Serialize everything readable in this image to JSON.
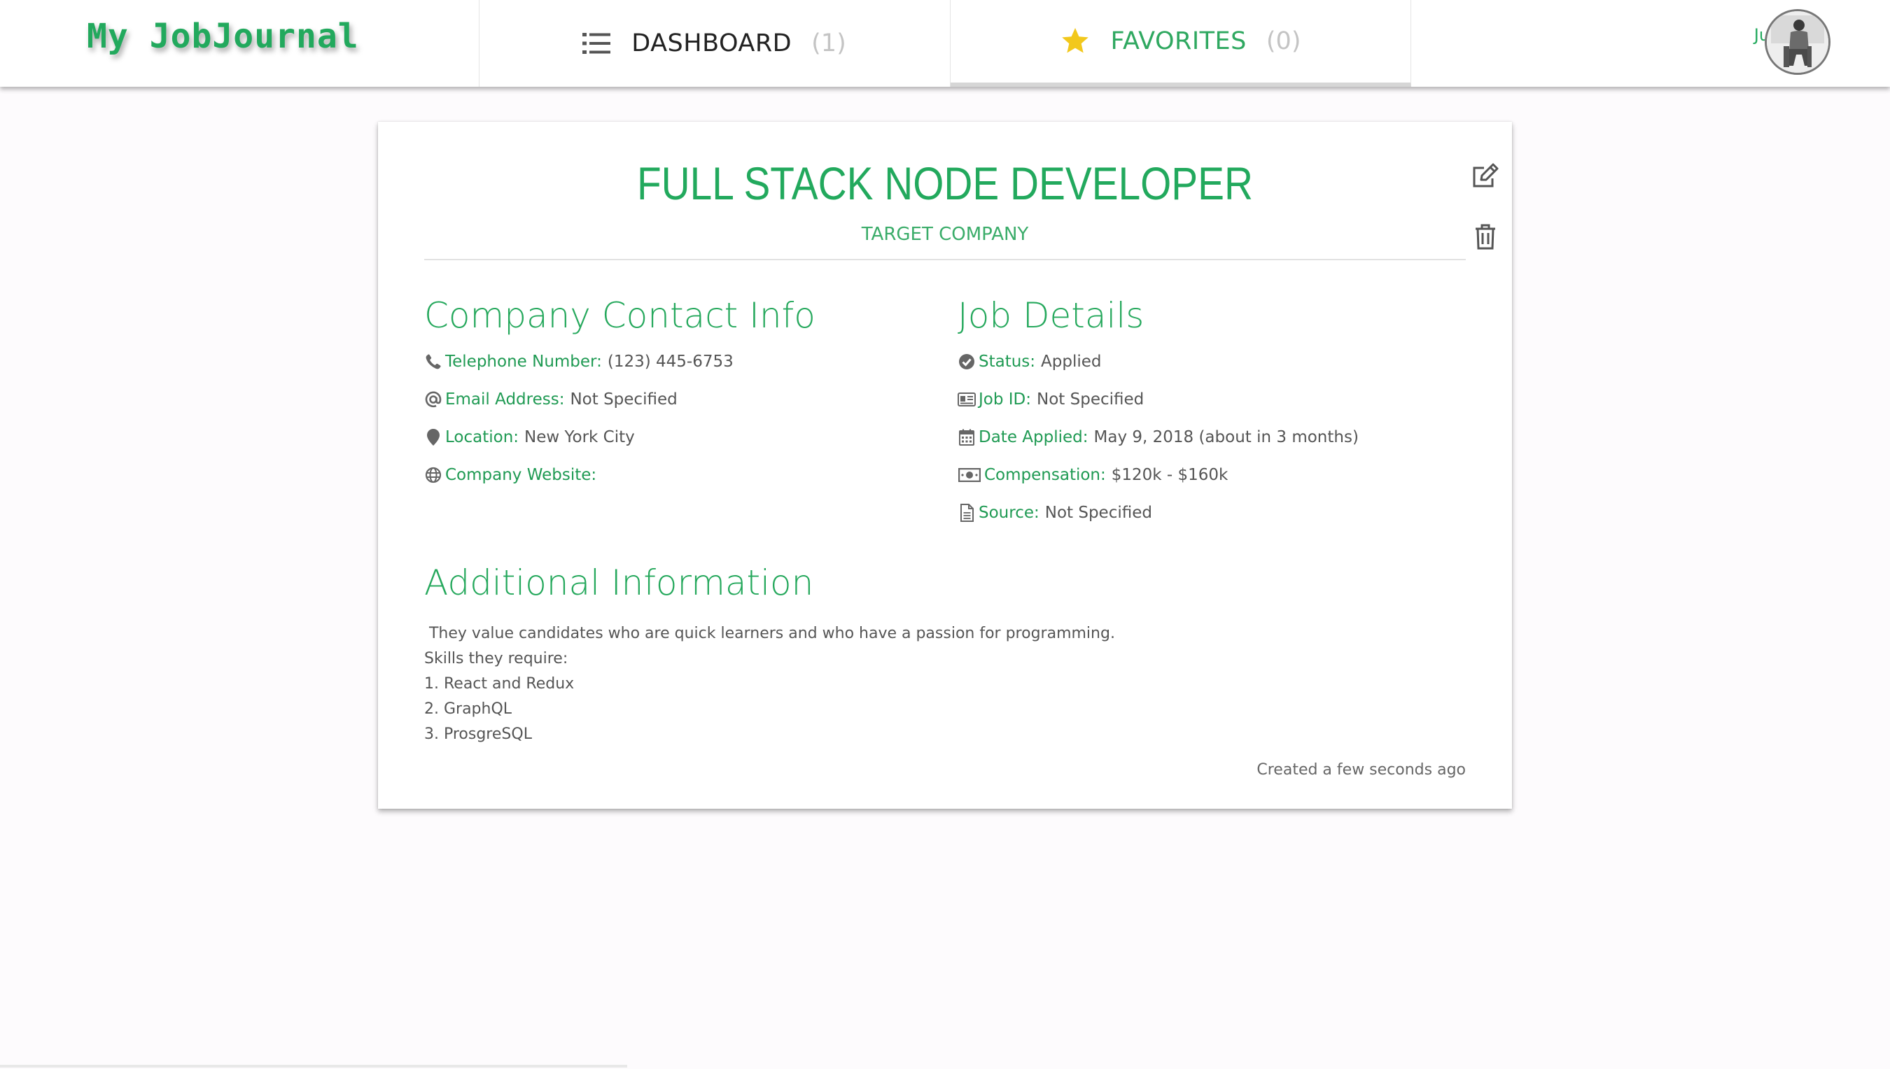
{
  "brand": {
    "name": "My JobJournal"
  },
  "nav": {
    "dashboard": {
      "label": "DASHBOARD",
      "count": "(1)",
      "icon": "list-icon"
    },
    "favorites": {
      "label": "FAVORITES",
      "count": "(0)",
      "icon": "star-icon"
    }
  },
  "user": {
    "name": "Juan",
    "avatar_icon": "avatar-photo"
  },
  "job": {
    "title": "FULL STACK NODE DEVELOPER",
    "company": "TARGET COMPANY",
    "actions": {
      "edit_icon": "edit-icon",
      "delete_icon": "trash-icon"
    }
  },
  "contact": {
    "title": "Company Contact Info",
    "fields": [
      {
        "label": "Telephone Number:",
        "value": "(123) 445-6753",
        "icon": "phone-icon"
      },
      {
        "label": "Email Address:",
        "value": "Not Specified",
        "icon": "at-icon"
      },
      {
        "label": "Location:",
        "value": "New York City",
        "icon": "map-marker-icon"
      },
      {
        "label": "Company Website:",
        "value": "",
        "icon": "globe-icon"
      }
    ]
  },
  "details": {
    "title": "Job Details",
    "fields": [
      {
        "label": "Status:",
        "value": "Applied",
        "icon": "check-circle-icon"
      },
      {
        "label": "Job ID:",
        "value": "Not Specified",
        "icon": "id-card-icon"
      },
      {
        "label": "Date Applied:",
        "value": "May 9, 2018 (about in 3 months)",
        "icon": "calendar-icon"
      },
      {
        "label": "Compensation:",
        "value": "$120k - $160k",
        "icon": "money-icon"
      },
      {
        "label": "Source:",
        "value": "Not Specified",
        "icon": "document-icon"
      }
    ]
  },
  "additional": {
    "title": "Additional Information",
    "lines": [
      " They value candidates who are quick learners and who have a passion for programming.",
      "Skills they require:",
      "1. React and Redux",
      "2. GraphQL",
      "3. ProsgreSQL"
    ]
  },
  "footer": {
    "created": "Created a few seconds ago"
  },
  "colors": {
    "accent": "#22a95d",
    "star": "#f2c81c",
    "muted": "#c4c4c4"
  }
}
